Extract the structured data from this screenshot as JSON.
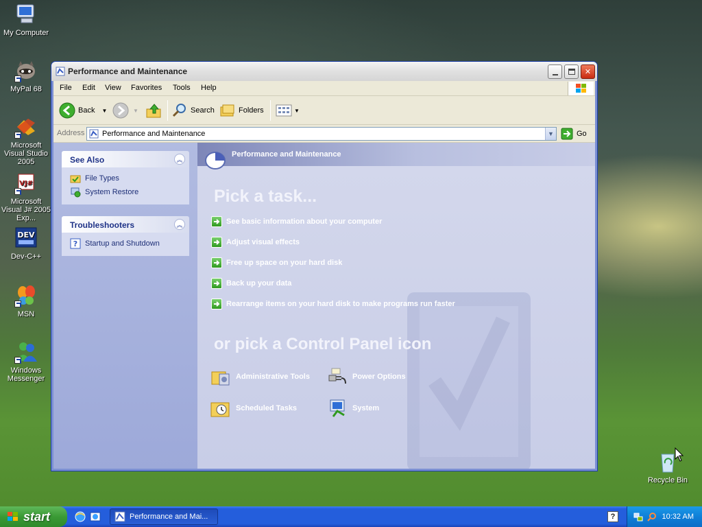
{
  "desktop": {
    "icons": [
      {
        "label": "My Computer",
        "icon": "computer-icon"
      },
      {
        "label": "MyPal 68",
        "icon": "raccoon-icon"
      },
      {
        "label": "Microsoft Visual Studio 2005",
        "icon": "visual-studio-icon"
      },
      {
        "label": "Microsoft Visual J# 2005 Exp...",
        "icon": "vj-icon"
      },
      {
        "label": "Dev-C++",
        "icon": "devcpp-icon"
      },
      {
        "label": "MSN",
        "icon": "msn-butterfly-icon"
      },
      {
        "label": "Windows Messenger",
        "icon": "messenger-icon"
      },
      {
        "label": "Recycle Bin",
        "icon": "recycle-bin-icon"
      }
    ]
  },
  "window": {
    "title": "Performance and Maintenance",
    "menu": [
      "File",
      "Edit",
      "View",
      "Favorites",
      "Tools",
      "Help"
    ],
    "toolbar": {
      "back": "Back",
      "search": "Search",
      "folders": "Folders"
    },
    "address": {
      "label": "Address",
      "value": "Performance and Maintenance",
      "go": "Go"
    }
  },
  "left_pane": {
    "see_also": {
      "title": "See Also",
      "items": [
        "File Types",
        "System Restore"
      ]
    },
    "troubleshooters": {
      "title": "Troubleshooters",
      "items": [
        "Startup and Shutdown"
      ]
    }
  },
  "main": {
    "category_title": "Performance and Maintenance",
    "pick_task": "Pick a task...",
    "tasks": [
      "See basic information about your computer",
      "Adjust visual effects",
      "Free up space on your hard disk",
      "Back up your data",
      "Rearrange items on your hard disk to make programs run faster"
    ],
    "pick_icon": "or pick a Control Panel icon",
    "cp_icons": [
      {
        "label": "Administrative Tools",
        "icon": "admin-tools-icon"
      },
      {
        "label": "Power Options",
        "icon": "power-options-icon"
      },
      {
        "label": "Scheduled Tasks",
        "icon": "scheduled-tasks-icon"
      },
      {
        "label": "System",
        "icon": "system-icon"
      }
    ]
  },
  "taskbar": {
    "start": "start",
    "task_button": "Performance and Mai...",
    "clock": "10:32 AM"
  },
  "colors": {
    "task_arrow": "#2f9a1f",
    "xp_blue": "#245edc",
    "start_green": "#3a9a35"
  }
}
